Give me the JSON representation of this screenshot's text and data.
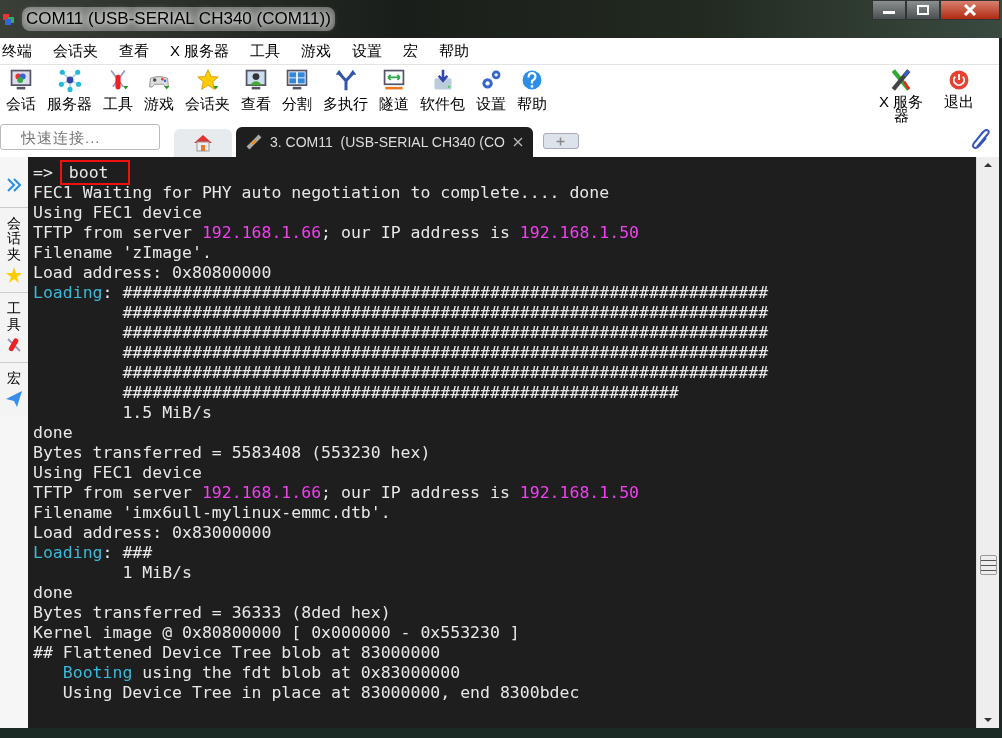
{
  "window": {
    "title": "COM11  (USB-SERIAL CH340 (COM11))"
  },
  "menu": [
    "终端",
    "会话夹",
    "查看",
    "X 服务器",
    "工具",
    "游戏",
    "设置",
    "宏",
    "帮助"
  ],
  "toolbar": [
    "会话",
    "服务器",
    "工具",
    "游戏",
    "会话夹",
    "查看",
    "分割",
    "多执行",
    "隧道",
    "软件包",
    "设置",
    "帮助"
  ],
  "toolbar_right": [
    "X 服务器",
    "退出"
  ],
  "quick_connect": {
    "placeholder": "快速连接..."
  },
  "tabs": [
    {
      "kind": "home",
      "selected": false
    },
    {
      "kind": "session",
      "label": "3. COM11  (USB-SERIAL CH340 (CO",
      "selected": true
    },
    {
      "kind": "new",
      "selected": false
    }
  ],
  "sidebar": [
    "会话夹",
    "工具",
    "宏"
  ],
  "terminal": [
    [
      {
        "text": "=> ",
        "kind": "plain"
      },
      {
        "text": "boot",
        "kind": "boxed"
      }
    ],
    [
      {
        "text": "FEC1 Waiting for PHY auto negotiation to complete.... done",
        "kind": "plain"
      }
    ],
    [
      {
        "text": "Using FEC1 device",
        "kind": "plain"
      }
    ],
    [
      {
        "text": "TFTP from server ",
        "kind": "plain"
      },
      {
        "text": "192.168.1.66",
        "kind": "address"
      },
      {
        "text": "; our IP address is ",
        "kind": "plain"
      },
      {
        "text": "192.168.1.50",
        "kind": "address"
      }
    ],
    [
      {
        "text": "Filename 'zImage'.",
        "kind": "plain"
      }
    ],
    [
      {
        "text": "Load address: 0x80800000",
        "kind": "plain"
      }
    ],
    [
      {
        "text": "Loading",
        "kind": "status"
      },
      {
        "text": ": #################################################################",
        "kind": "plain"
      }
    ],
    [
      {
        "text": "         #################################################################",
        "kind": "plain"
      }
    ],
    [
      {
        "text": "         #################################################################",
        "kind": "plain"
      }
    ],
    [
      {
        "text": "         #################################################################",
        "kind": "plain"
      }
    ],
    [
      {
        "text": "         #################################################################",
        "kind": "plain"
      }
    ],
    [
      {
        "text": "         ########################################################",
        "kind": "plain"
      }
    ],
    [
      {
        "text": "         1.5 MiB/s",
        "kind": "plain"
      }
    ],
    [
      {
        "text": "done",
        "kind": "plain"
      }
    ],
    [
      {
        "text": "Bytes transferred = 5583408 (553230 hex)",
        "kind": "plain"
      }
    ],
    [
      {
        "text": "Using FEC1 device",
        "kind": "plain"
      }
    ],
    [
      {
        "text": "TFTP from server ",
        "kind": "plain"
      },
      {
        "text": "192.168.1.66",
        "kind": "address"
      },
      {
        "text": "; our IP address is ",
        "kind": "plain"
      },
      {
        "text": "192.168.1.50",
        "kind": "address"
      }
    ],
    [
      {
        "text": "Filename 'imx6ull-mylinux-emmc.dtb'.",
        "kind": "plain"
      }
    ],
    [
      {
        "text": "Load address: 0x83000000",
        "kind": "plain"
      }
    ],
    [
      {
        "text": "Loading",
        "kind": "status"
      },
      {
        "text": ": ###",
        "kind": "plain"
      }
    ],
    [
      {
        "text": "         1 MiB/s",
        "kind": "plain"
      }
    ],
    [
      {
        "text": "done",
        "kind": "plain"
      }
    ],
    [
      {
        "text": "Bytes transferred = 36333 (8ded hex)",
        "kind": "plain"
      }
    ],
    [
      {
        "text": "Kernel image @ 0x80800000 [ 0x000000 - 0x553230 ]",
        "kind": "plain"
      }
    ],
    [
      {
        "text": "## Flattened Device Tree blob at 83000000",
        "kind": "plain"
      }
    ],
    [
      {
        "text": "Booting",
        "kind": "indented_status"
      },
      {
        "text": " using the fdt blob at 0x83000000",
        "kind": "plain"
      }
    ],
    [
      {
        "text": "   Using Device Tree in place at 83000000, end 8300bdec",
        "kind": "plain"
      }
    ]
  ]
}
